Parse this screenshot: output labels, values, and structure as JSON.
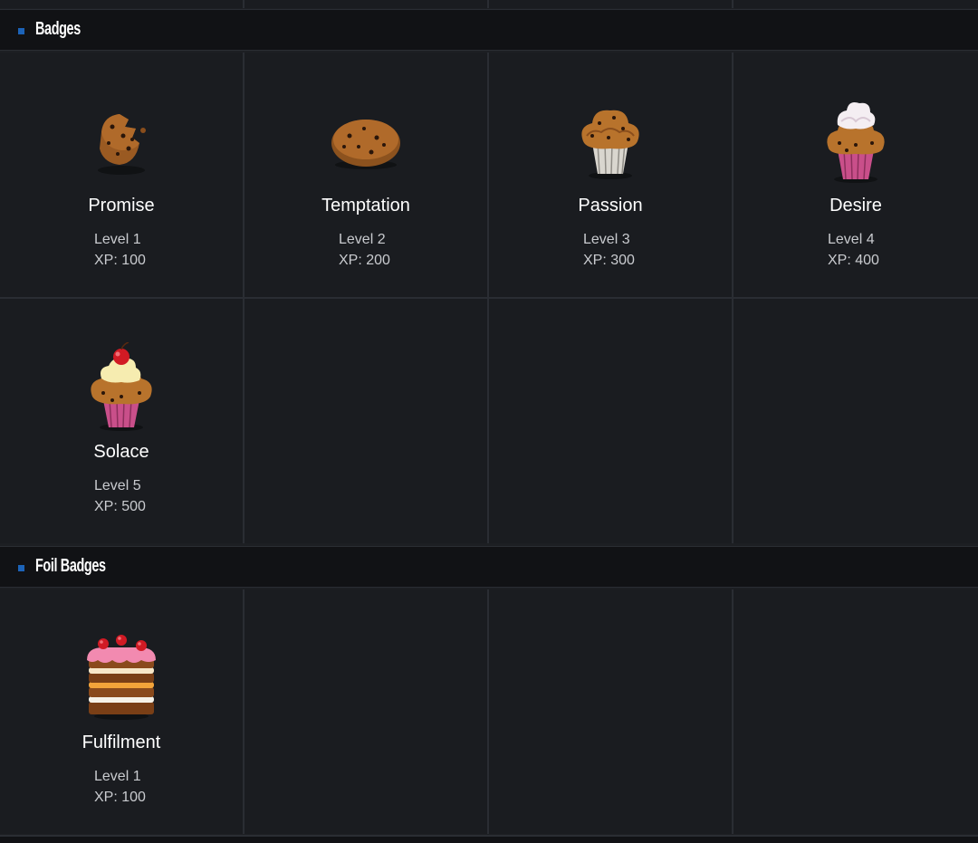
{
  "sections": [
    {
      "title": "Badges",
      "badges": [
        {
          "name": "Promise",
          "level": "Level 1",
          "xp": "XP: 100",
          "icon": "broken-cookie-icon"
        },
        {
          "name": "Temptation",
          "level": "Level 2",
          "xp": "XP: 200",
          "icon": "cookie-icon"
        },
        {
          "name": "Passion",
          "level": "Level 3",
          "xp": "XP: 300",
          "icon": "muffin-icon"
        },
        {
          "name": "Desire",
          "level": "Level 4",
          "xp": "XP: 400",
          "icon": "cream-cupcake-icon"
        },
        {
          "name": "Solace",
          "level": "Level 5",
          "xp": "XP: 500",
          "icon": "cherry-cupcake-icon"
        }
      ]
    },
    {
      "title": "Foil Badges",
      "badges": [
        {
          "name": "Fulfilment",
          "level": "Level 1",
          "xp": "XP: 100",
          "icon": "layer-cake-icon"
        }
      ]
    }
  ],
  "colors": {
    "background": "#1a1c20",
    "header_background": "#111215",
    "marker": "#1c63b8",
    "grid_lines": "#2a2d33",
    "muffin": "#b8732c",
    "cupcake_wrapper": "#c94f8a"
  }
}
